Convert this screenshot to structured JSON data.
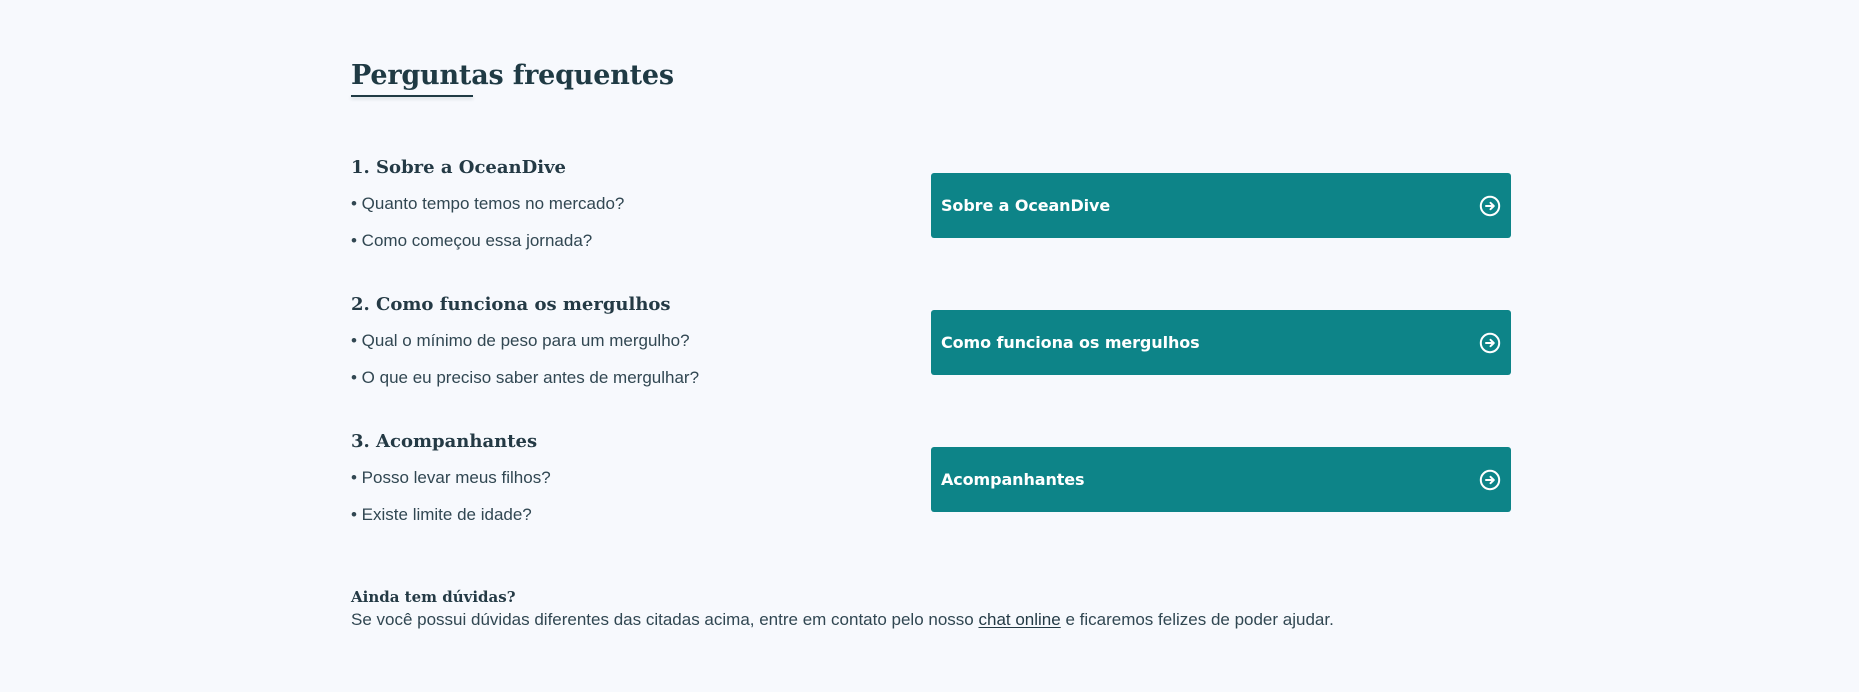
{
  "page": {
    "title": "Perguntas frequentes"
  },
  "colors": {
    "background": "#f7f9fd",
    "text": "#243a45",
    "accent": "#0d8488",
    "button_text": "#ffffff"
  },
  "sections": [
    {
      "title": "1. Sobre a OceanDive",
      "questions": [
        "• Quanto tempo temos no mercado?",
        "• Como começou essa jornada?"
      ],
      "button": {
        "label": "Sobre a OceanDive",
        "icon": "arrow-circle-right-icon"
      }
    },
    {
      "title": "2. Como funciona os mergulhos",
      "questions": [
        "• Qual o mínimo de peso para um mergulho?",
        "• O que eu preciso saber antes de mergulhar?"
      ],
      "button": {
        "label": "Como funciona os mergulhos",
        "icon": "arrow-circle-right-icon"
      }
    },
    {
      "title": "3. Acompanhantes",
      "questions": [
        "• Posso levar meus filhos?",
        "• Existe limite de idade?"
      ],
      "button": {
        "label": "Acompanhantes",
        "icon": "arrow-circle-right-icon"
      }
    }
  ],
  "help": {
    "title": "Ainda tem dúvidas?",
    "text_before": "Se você possui dúvidas diferentes das citadas acima, entre em contato pelo nosso ",
    "link": "chat online",
    "text_after": " e ficaremos felizes de poder ajudar."
  }
}
